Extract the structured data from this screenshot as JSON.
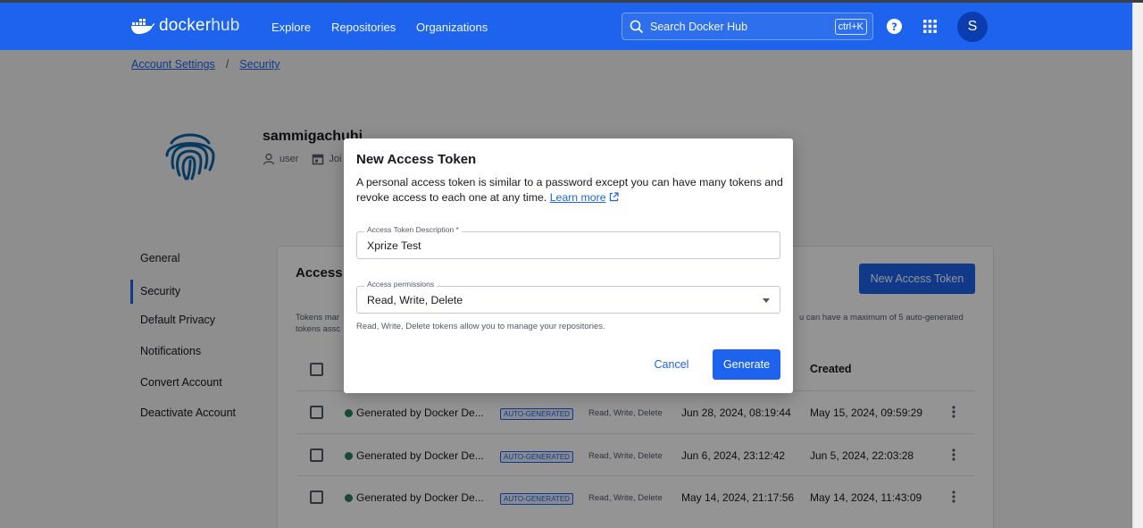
{
  "nav": {
    "logo_word_1": "docker",
    "logo_word_2": "hub",
    "links": [
      "Explore",
      "Repositories",
      "Organizations"
    ],
    "search_placeholder": "Search Docker Hub",
    "search_shortcut": "ctrl+K",
    "avatar_initial": "S"
  },
  "breadcrumb": {
    "parent": "Account Settings",
    "separator": "/",
    "current": "Security"
  },
  "profile": {
    "username": "sammigachuhi",
    "role": "user",
    "joined_partial": "Joi"
  },
  "sidebar": {
    "items": [
      {
        "label": "General"
      },
      {
        "label": "Security"
      },
      {
        "label": "Default Privacy"
      },
      {
        "label": "Notifications"
      },
      {
        "label": "Convert Account"
      },
      {
        "label": "Deactivate Account"
      }
    ],
    "active": "Security"
  },
  "main": {
    "title_partial": "Access T",
    "new_token_button": "New Access Token",
    "desc_left_1": "Tokens mar",
    "desc_left_2": "tokens assc",
    "desc_right": "u can have a maximum of 5 auto-generated",
    "col_created": "Created",
    "rows": [
      {
        "name": "Generated by Docker De...",
        "badge": "AUTO-GENERATED",
        "permissions": "Read, Write, Delete",
        "last_used": "Jun 28, 2024, 08:19:44",
        "created": "May 15, 2024, 09:59:29"
      },
      {
        "name": "Generated by Docker De...",
        "badge": "AUTO-GENERATED",
        "permissions": "Read, Write, Delete",
        "last_used": "Jun 6, 2024, 23:12:42",
        "created": "Jun 5, 2024, 22:03:28"
      },
      {
        "name": "Generated by Docker De...",
        "badge": "AUTO-GENERATED",
        "permissions": "Read, Write, Delete",
        "last_used": "May 14, 2024, 21:17:56",
        "created": "May 14, 2024, 11:43:09"
      }
    ]
  },
  "modal": {
    "title": "New Access Token",
    "paragraph": "A personal access token is similar to a password except you can have many tokens and revoke access to each one at any time.",
    "learn_more": "Learn more",
    "description_label": "Access Token Description *",
    "description_value": "Xprize Test",
    "permissions_label": "Access permissions",
    "permissions_value": "Read, Write, Delete",
    "helper_text": "Read, Write, Delete tokens allow you to manage your repositories.",
    "cancel": "Cancel",
    "generate": "Generate"
  },
  "colors": {
    "brand_blue": "#1d63ed",
    "status_green": "#2e7d5b"
  }
}
